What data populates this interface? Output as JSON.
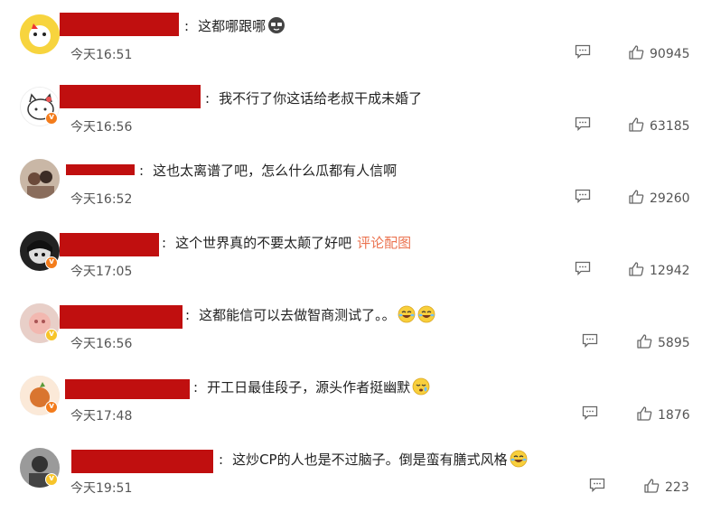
{
  "comments": [
    {
      "text": "这都哪跟哪",
      "time": "今天16:51",
      "likes": "90945",
      "emoji": [
        "cool-face"
      ]
    },
    {
      "text": "我不行了你这话给老叔干成未婚了",
      "time": "今天16:56",
      "likes": "63185",
      "emoji": []
    },
    {
      "text": "这也太离谱了吧，怎么什么瓜都有人信啊",
      "time": "今天16:52",
      "likes": "29260",
      "emoji": []
    },
    {
      "text": "这个世界真的不要太颠了好吧",
      "link": "评论配图",
      "time": "今天17:05",
      "likes": "12942",
      "emoji": []
    },
    {
      "text": "这都能信可以去做智商测试了。。",
      "time": "今天16:56",
      "likes": "5895",
      "emoji": [
        "laugh-cry",
        "laugh-cry"
      ]
    },
    {
      "text": "开工日最佳段子，源头作者挺幽默",
      "time": "今天17:48",
      "likes": "1876",
      "emoji": [
        "tear-face"
      ]
    },
    {
      "text": "这炒CP的人也是不过脑子。倒是蛮有膳式风格",
      "time": "今天19:51",
      "likes": "223",
      "emoji": [
        "laugh-cry"
      ]
    }
  ],
  "colors": {
    "redaction": "#c00f0f",
    "link": "#eb7350",
    "badge_orange": "#f37c1c",
    "badge_yellow": "#f7c42a"
  }
}
